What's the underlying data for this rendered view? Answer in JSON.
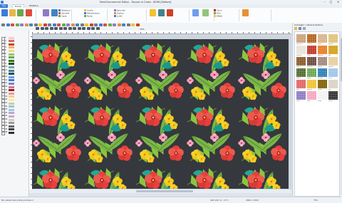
{
  "window": {
    "title": "PaintCommercial Editor - Toucan in Carta - 8096 [Editore]",
    "minimize": "–",
    "maximize": "□",
    "close": "×"
  },
  "ribbon_tabs": [
    "File",
    "Home",
    "Modifica"
  ],
  "ribbon_small": [
    {
      "label": "Seleziona",
      "color": "#3b7dd8"
    },
    {
      "label": "Cancella",
      "color": "#e04b3c"
    },
    {
      "label": "Copia",
      "color": "#6aa84f"
    },
    {
      "label": "Incolla",
      "color": "#f1c232"
    },
    {
      "label": "Ridimensiona",
      "color": "#3b7dd8"
    },
    {
      "label": "Ruota",
      "color": "#6aa84f"
    },
    {
      "label": "Specchia",
      "color": "#8e7cc3"
    },
    {
      "label": "Duplica",
      "color": "#e69138"
    },
    {
      "label": "Livelli",
      "color": "#3d85c6"
    },
    {
      "label": "Colori",
      "color": "#cc0000"
    },
    {
      "label": "Filtri",
      "color": "#6aa84f"
    },
    {
      "label": "Effetti",
      "color": "#f1c232"
    }
  ],
  "zoom": "75%",
  "left_panel_rows": [
    {
      "num": "1",
      "color": "#f4cccc"
    },
    {
      "num": "2",
      "color": "#e06666"
    },
    {
      "num": "3",
      "color": "#cc4125"
    },
    {
      "num": "4",
      "color": "#f6b26b"
    },
    {
      "num": "5",
      "color": "#ffd966"
    },
    {
      "num": "6",
      "color": "#93c47d"
    },
    {
      "num": "7",
      "color": "#6aa84f"
    },
    {
      "num": "8",
      "color": "#38761d"
    },
    {
      "num": "9",
      "color": "#274e13"
    },
    {
      "num": "10",
      "color": "#76a5af"
    },
    {
      "num": "11",
      "color": "#45818e"
    },
    {
      "num": "12",
      "color": "#134f5c"
    },
    {
      "num": "13",
      "color": "#6d9eeb"
    },
    {
      "num": "14",
      "color": "#3c78d8"
    },
    {
      "num": "15",
      "color": "#8e7cc3"
    },
    {
      "num": "16",
      "color": "#c27ba0"
    },
    {
      "num": "17",
      "color": "#a61c00"
    },
    {
      "num": "18",
      "color": "#ea9999"
    },
    {
      "num": "19",
      "color": "#f9cb9c"
    },
    {
      "num": "20",
      "color": "#ffe599"
    },
    {
      "num": "21",
      "color": "#b6d7a8"
    },
    {
      "num": "22",
      "color": "#a2c4c9"
    },
    {
      "num": "23",
      "color": "#9fc5e8"
    },
    {
      "num": "24",
      "color": "#b4a7d6"
    },
    {
      "num": "25",
      "color": "#d5a6bd"
    },
    {
      "num": "26",
      "color": "#cccccc"
    },
    {
      "num": "27",
      "color": "#999999"
    },
    {
      "num": "28",
      "color": "#666666"
    },
    {
      "num": "29",
      "color": "#434343"
    },
    {
      "num": "30",
      "color": "#2e3033"
    }
  ],
  "right_panel": {
    "title": "Immagini / Libreria texture",
    "thumbs": [
      {
        "cap": "carta_01",
        "color": "#c9a27a"
      },
      {
        "cap": "tessuto",
        "color": "#b5651d"
      },
      {
        "cap": "legno",
        "color": "#d9b38c"
      },
      {
        "cap": "paglia",
        "color": "#e0c27a"
      },
      {
        "cap": "marmo",
        "color": "#e8e2d8"
      },
      {
        "cap": "rosso",
        "color": "#c0392b"
      },
      {
        "cap": "arancio",
        "color": "#e67e22"
      },
      {
        "cap": "oro",
        "color": "#d4a017"
      },
      {
        "cap": "cuoio",
        "color": "#8b5a2b"
      },
      {
        "cap": "mosaico",
        "color": "#6d4c41"
      },
      {
        "cap": "pietra",
        "color": "#a1887f"
      },
      {
        "cap": "sabbia",
        "color": "#e6cf9b"
      },
      {
        "cap": "bosco",
        "color": "#556b2f"
      },
      {
        "cap": "foglie",
        "color": "#6aa84f"
      },
      {
        "cap": "oceano",
        "color": "#2c7fb8"
      },
      {
        "cap": "cielo",
        "color": "#9fc5e8"
      },
      {
        "cap": "fiori",
        "color": "#e06666"
      },
      {
        "cap": "motivo",
        "color": "#f1c232"
      },
      {
        "cap": "tribale",
        "color": "#7f6000"
      },
      {
        "cap": "lino",
        "color": "#d9d2c5"
      },
      {
        "cap": "viola",
        "color": "#8e7cc3"
      },
      {
        "cap": "rosa",
        "color": "#f4a6c0"
      },
      {
        "cap": "pizzo",
        "color": "#f3f3f3"
      },
      {
        "cap": "scuro",
        "color": "#333333"
      }
    ]
  },
  "status": {
    "left": "Per selezionare parte premere il",
    "mid": "148 100  ( 0 , 177 )",
    "coords": "2000 x 1500",
    "zoom": "75%"
  }
}
